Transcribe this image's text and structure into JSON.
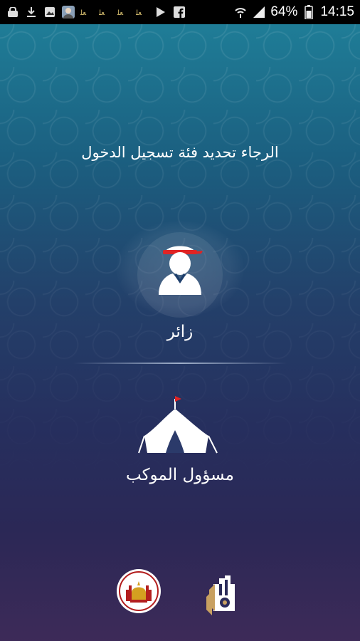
{
  "status_bar": {
    "left_icons": [
      "lock-icon",
      "download-icon",
      "image-icon",
      "avatar-icon",
      "notification-icon",
      "notification-icon",
      "notification-icon",
      "notification-icon",
      "play-store-icon",
      "facebook-icon"
    ],
    "battery_percent": "64%",
    "time": "14:15"
  },
  "login": {
    "prompt": "الرجاء تحديد فئة تسجيل الدخول",
    "visitor_label": "زائر",
    "host_label": "مسؤول الموكب"
  },
  "colors": {
    "accent_red": "#e02424",
    "text": "#ffffff"
  }
}
